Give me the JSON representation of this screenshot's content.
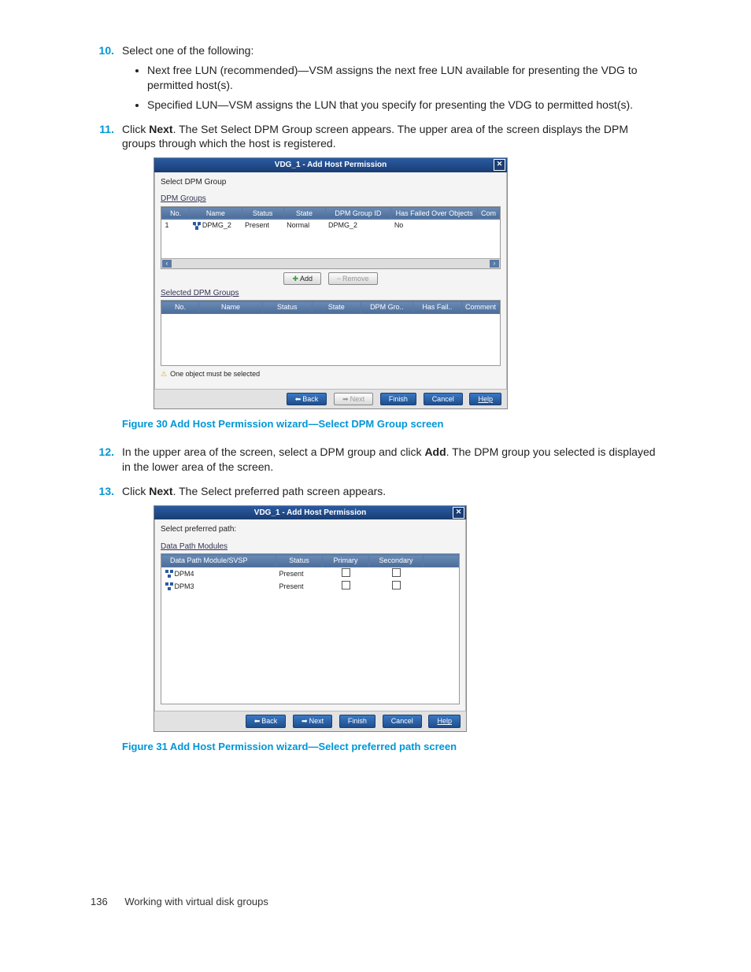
{
  "steps": {
    "s10": {
      "num": "10.",
      "text": "Select one of the following:",
      "bullets": [
        "Next free LUN (recommended)—VSM assigns the next free LUN available for presenting the VDG to permitted host(s).",
        "Specified LUN—VSM assigns the LUN that you specify for presenting the VDG to permitted host(s)."
      ]
    },
    "s11": {
      "num": "11.",
      "pre": "Click ",
      "bold": "Next",
      "post": ". The Set Select DPM Group screen appears. The upper area of the screen displays the DPM groups through which the host is registered."
    },
    "s12": {
      "num": "12.",
      "pre": "In the upper area of the screen, select a DPM group and click ",
      "bold": "Add",
      "post": ". The DPM group you selected is displayed in the lower area of the screen."
    },
    "s13": {
      "num": "13.",
      "pre": "Click ",
      "bold": "Next",
      "post": ". The Select preferred path screen appears."
    }
  },
  "fig30": {
    "caption": "Figure 30 Add Host Permission wizard—Select DPM Group screen",
    "title": "VDG_1 - Add Host Permission",
    "section1": "Select DPM Group",
    "section2": "DPM Groups",
    "section3": "Selected DPM Groups",
    "headers1": [
      "No.",
      "Name",
      "Status",
      "State",
      "DPM Group ID",
      "Has Failed Over Objects",
      "Com"
    ],
    "row1": [
      "1",
      "DPMG_2",
      "Present",
      "Normal",
      "DPMG_2",
      "No",
      ""
    ],
    "headers2": [
      "No.",
      "Name",
      "Status",
      "State",
      "DPM Gro..",
      "Has Fail..",
      "Comment"
    ],
    "add": "Add",
    "remove": "Remove",
    "warn": "One object must be selected",
    "back": "Back",
    "next": "Next",
    "finish": "Finish",
    "cancel": "Cancel",
    "help": "Help"
  },
  "fig31": {
    "caption": "Figure 31 Add Host Permission wizard—Select preferred path screen",
    "title": "VDG_1 - Add Host Permission",
    "section1": "Select preferred path:",
    "section2": "Data Path Modules",
    "headers": [
      "Data Path Module/SVSP",
      "Status",
      "Primary",
      "Secondary"
    ],
    "rows": [
      [
        "DPM4",
        "Present"
      ],
      [
        "DPM3",
        "Present"
      ]
    ],
    "back": "Back",
    "next": "Next",
    "finish": "Finish",
    "cancel": "Cancel",
    "help": "Help"
  },
  "footer": {
    "page": "136",
    "section": "Working with virtual disk groups"
  }
}
